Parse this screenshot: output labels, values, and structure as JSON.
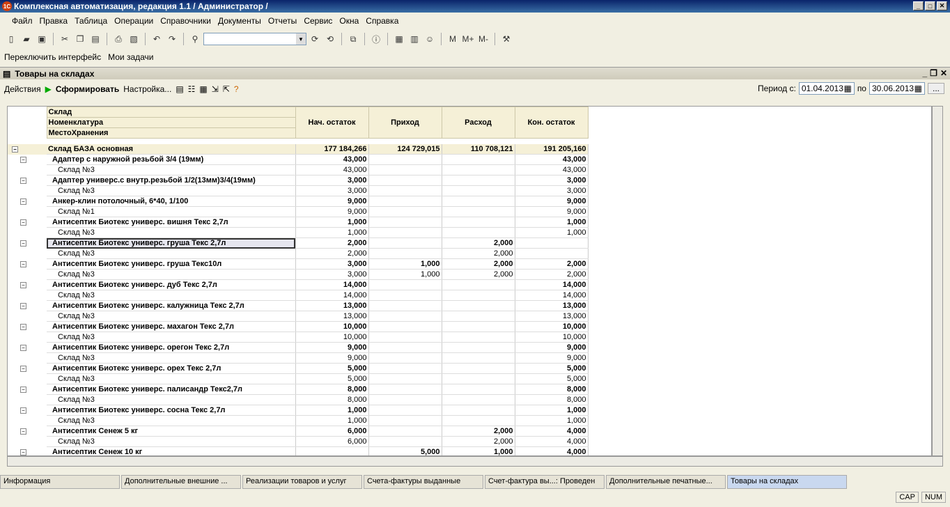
{
  "window": {
    "title": "Комплексная автоматизация, редакция 1.1 / Администратор /"
  },
  "menu": [
    "Файл",
    "Правка",
    "Таблица",
    "Операции",
    "Справочники",
    "Документы",
    "Отчеты",
    "Сервис",
    "Окна",
    "Справка"
  ],
  "toolbar2": {
    "switch_label": "Переключить интерфейс",
    "tasks_label": "Мои задачи"
  },
  "toolbar1": {
    "m": "M",
    "mplus": "M+",
    "mminus": "M-"
  },
  "form": {
    "title": "Товары на складах",
    "actions": "Действия",
    "run": "Сформировать",
    "settings": "Настройка..."
  },
  "period": {
    "from_label": "Период с:",
    "from": "01.04.2013",
    "to_label": "по",
    "to": "30.06.2013",
    "more": "..."
  },
  "header": {
    "l1": "Склад",
    "l2": "Номенклатура",
    "l3": "МестоХранения",
    "c1": "Нач. остаток",
    "c2": "Приход",
    "c3": "Расход",
    "c4": "Кон. остаток"
  },
  "rows": [
    {
      "t": "grp",
      "name": "Склад БАЗА основная",
      "v": [
        "177 184,266",
        "124 729,015",
        "110 708,121",
        "191 205,160"
      ]
    },
    {
      "t": "item",
      "name": "Адаптер с наружной резьбой 3/4 (19мм)",
      "v": [
        "43,000",
        "",
        "",
        "43,000"
      ]
    },
    {
      "t": "sub",
      "name": "Склад №3",
      "v": [
        "43,000",
        "",
        "",
        "43,000"
      ]
    },
    {
      "t": "item",
      "name": "Адаптер универс.с внутр.резьбой 1/2(13мм)3/4(19мм)",
      "v": [
        "3,000",
        "",
        "",
        "3,000"
      ]
    },
    {
      "t": "sub",
      "name": "Склад №3",
      "v": [
        "3,000",
        "",
        "",
        "3,000"
      ]
    },
    {
      "t": "item",
      "name": "Анкер-клин потолочный, 6*40, 1/100",
      "v": [
        "9,000",
        "",
        "",
        "9,000"
      ]
    },
    {
      "t": "sub",
      "name": "Склад №1",
      "v": [
        "9,000",
        "",
        "",
        "9,000"
      ]
    },
    {
      "t": "item",
      "name": "Антисептик Биотекс универс. вишня Текс 2,7л",
      "v": [
        "1,000",
        "",
        "",
        "1,000"
      ]
    },
    {
      "t": "sub",
      "name": "Склад №3",
      "v": [
        "1,000",
        "",
        "",
        "1,000"
      ]
    },
    {
      "t": "item",
      "name": "Антисептик Биотекс универс. груша Текс 2,7л",
      "v": [
        "2,000",
        "",
        "2,000",
        ""
      ],
      "sel": true
    },
    {
      "t": "sub",
      "name": "Склад №3",
      "v": [
        "2,000",
        "",
        "2,000",
        ""
      ]
    },
    {
      "t": "item",
      "name": "Антисептик Биотекс универс. груша Текс10л",
      "v": [
        "3,000",
        "1,000",
        "2,000",
        "2,000"
      ]
    },
    {
      "t": "sub",
      "name": "Склад №3",
      "v": [
        "3,000",
        "1,000",
        "2,000",
        "2,000"
      ]
    },
    {
      "t": "item",
      "name": "Антисептик Биотекс универс. дуб Текс 2,7л",
      "v": [
        "14,000",
        "",
        "",
        "14,000"
      ]
    },
    {
      "t": "sub",
      "name": "Склад №3",
      "v": [
        "14,000",
        "",
        "",
        "14,000"
      ]
    },
    {
      "t": "item",
      "name": "Антисептик Биотекс универс. калужница Текс 2,7л",
      "v": [
        "13,000",
        "",
        "",
        "13,000"
      ]
    },
    {
      "t": "sub",
      "name": "Склад №3",
      "v": [
        "13,000",
        "",
        "",
        "13,000"
      ]
    },
    {
      "t": "item",
      "name": "Антисептик Биотекс универс. махагон Текс 2,7л",
      "v": [
        "10,000",
        "",
        "",
        "10,000"
      ]
    },
    {
      "t": "sub",
      "name": "Склад №3",
      "v": [
        "10,000",
        "",
        "",
        "10,000"
      ]
    },
    {
      "t": "item",
      "name": "Антисептик Биотекс универс. орегон Текс 2,7л",
      "v": [
        "9,000",
        "",
        "",
        "9,000"
      ]
    },
    {
      "t": "sub",
      "name": "Склад №3",
      "v": [
        "9,000",
        "",
        "",
        "9,000"
      ]
    },
    {
      "t": "item",
      "name": "Антисептик Биотекс универс. орех Текс 2,7л",
      "v": [
        "5,000",
        "",
        "",
        "5,000"
      ]
    },
    {
      "t": "sub",
      "name": "Склад №3",
      "v": [
        "5,000",
        "",
        "",
        "5,000"
      ]
    },
    {
      "t": "item",
      "name": "Антисептик Биотекс универс. палисандр Текс2,7л",
      "v": [
        "8,000",
        "",
        "",
        "8,000"
      ]
    },
    {
      "t": "sub",
      "name": "Склад №3",
      "v": [
        "8,000",
        "",
        "",
        "8,000"
      ]
    },
    {
      "t": "item",
      "name": "Антисептик Биотекс универс. сосна Текс 2,7л",
      "v": [
        "1,000",
        "",
        "",
        "1,000"
      ]
    },
    {
      "t": "sub",
      "name": "Склад №3",
      "v": [
        "1,000",
        "",
        "",
        "1,000"
      ]
    },
    {
      "t": "item",
      "name": "Антисептик Сенеж  5 кг",
      "v": [
        "6,000",
        "",
        "2,000",
        "4,000"
      ]
    },
    {
      "t": "sub",
      "name": "Склад №3",
      "v": [
        "6,000",
        "",
        "2,000",
        "4,000"
      ]
    },
    {
      "t": "item",
      "name": "Антисептик Сенеж  10 кг",
      "v": [
        "",
        "5,000",
        "1,000",
        "4,000"
      ]
    }
  ],
  "tasks": [
    "Информация",
    "Дополнительные внешние ...",
    "Реализации товаров и услуг",
    "Счета-фактуры выданные",
    "Счет-фактура вы...: Проведен",
    "Дополнительные печатные...",
    "Товары на складах"
  ],
  "status": {
    "cap": "CAP",
    "num": "NUM"
  }
}
